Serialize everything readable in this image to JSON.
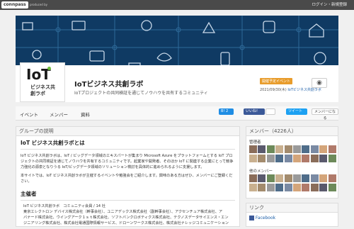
{
  "topbar": {
    "logo": "connpass",
    "logo_sub": "produced by ",
    "links": "ログイン・新規登録"
  },
  "group": {
    "name": "IoTビジネス共創ラボ",
    "subtitle": "IoTプロジェクトの共同検証を通じてノウハウを共有するコミュニティ",
    "logo_text": "IoT",
    "logo_jp": "ビジネス共創ラボ"
  },
  "event": {
    "badge": "開催予定イベント",
    "date": "2021/09/30(木)",
    "title": "IoTビジネス共創ラボ"
  },
  "tabs": [
    "イベント",
    "メンバー",
    "資料"
  ],
  "share": {
    "hatena": "B! 2",
    "fb_like": "いいね! 354",
    "fb_count": "",
    "tweet": "ツイート",
    "join": "メンバーになる"
  },
  "description": {
    "header": "グループの説明",
    "heading": "IoT ビジネス共創ラボとは",
    "para1": "IoT ビジネス共創ラボは、IoT / ビッグデータ領域のエキスパートが集まり Microsoft Azure をプラットフォームとする IoT プロジェクトの共同検証を通じてノウハウを共有するコミュニティです。起業家や開発者、そのほか IoT に関連する企業にとって競争力強化の源泉となりうる IoT/ビッグデータ領域のソリューション検討を具体的に進められるように支援します。",
    "para2": "本サイトでは、IoT ビジネス共創ラボが主催するイベントや勉強会をご紹介します。興味のある方はぜひ、メンバーにご登録ください。",
    "organizer_heading": "主催者",
    "organizer_line1": "IoT ビジネス共創ラボ　コミュニティ会員 / 14 社",
    "organizer_line2": "東京エレクトロン デバイス株式会社（幹事会社）、ユニアデックス株式会社（副幹事会社）、アクセンチュア株式会社、ア",
    "organizer_line3": "バナード株式会社、ウイングアーク１ｓｔ株式会社、ソフトバンクロボティクス株式会社、テクノスデータサイエンス・エン",
    "organizer_line4": "ジニアリング株式会社、株式会社電通国際情報サービス、ドローンワークス株式会社、株式会社ナレッジコミュニケーション"
  },
  "members": {
    "header": "メンバー（4226人）",
    "admin_label": "管理者",
    "other_label": "他のメンバー"
  },
  "links_panel": {
    "header": "リンク",
    "facebook": "Facebook"
  },
  "colors": {
    "hero_bg": "#0f3a63",
    "badge": "#e89c2b",
    "link": "#1a5da8"
  }
}
